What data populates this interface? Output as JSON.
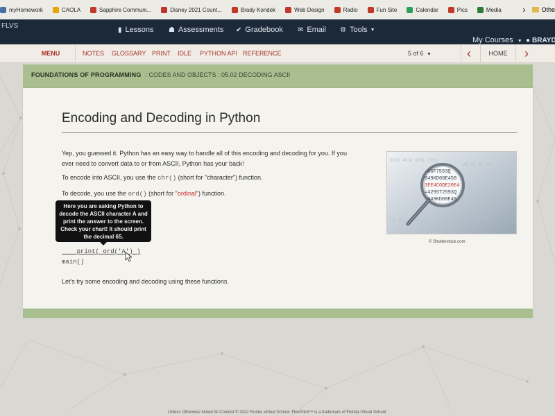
{
  "bookmarks": [
    {
      "label": "myHomework",
      "color": "#4a6fa5"
    },
    {
      "label": "CAOLA",
      "color": "#e8a500"
    },
    {
      "label": "Sapphire Communi...",
      "color": "#c0392b"
    },
    {
      "label": "Disney 2021 Count...",
      "color": "#b33"
    },
    {
      "label": "Brady Kondek",
      "color": "#c0392b"
    },
    {
      "label": "Web Design",
      "color": "#c0392b"
    },
    {
      "label": "Radio",
      "color": "#c0392b"
    },
    {
      "label": "Fun Site",
      "color": "#c0392b"
    },
    {
      "label": "Calendar",
      "color": "#2f9e5a"
    },
    {
      "label": "Pics",
      "color": "#c0392b"
    },
    {
      "label": "Media",
      "color": "#2e7d32"
    }
  ],
  "bookmarks_overflow": "›",
  "bookmarks_other": "Othe",
  "topnav": {
    "brand": "FLVS",
    "items": [
      {
        "label": "Lessons",
        "icon": "book-icon"
      },
      {
        "label": "Assessments",
        "icon": "assessment-icon"
      },
      {
        "label": "Gradebook",
        "icon": "check-icon"
      },
      {
        "label": "Email",
        "icon": "mail-icon"
      },
      {
        "label": "Tools",
        "icon": "gear-icon"
      }
    ],
    "my_courses": "My Courses",
    "user": "BRAYD"
  },
  "menubar": {
    "menu_label": "MENU",
    "items": [
      "NOTES",
      "GLOSSARY",
      "PRINT",
      "IDLE",
      "PYTHON API",
      "REFERENCE"
    ],
    "pager": "5 of 6",
    "home": "HOME"
  },
  "course": {
    "name": "FOUNDATIONS OF PROGRAMMING",
    "breadcrumb": ": CODES AND OBJECTS : 05.02 DECODING ASCII"
  },
  "lesson": {
    "title": "Encoding and Decoding in Python",
    "para1": "Yep, you guessed it. Python has an easy way to handle all of this encoding and decoding for you. If you",
    "para1b": "ever need to convert data to or from ASCII, Python has your back!",
    "encode_pre": "To encode into ASCII, you use the ",
    "encode_code": "chr()",
    "encode_post": " (short for \"character\") function.",
    "decode_pre": "To decode, you use the ",
    "decode_code": "ord()",
    "decode_mid": " (short for \"",
    "decode_ordinal": "ordinal",
    "decode_post": "\") function.",
    "tooltip": "Here you are asking Python to decode the ASCII character A and print the answer to the screen. Check your chart! It should print the decimal 65.",
    "code_line1": "    print( ord('A') )",
    "code_line2": "main()",
    "closing": "Let's try some encoding and decoding using these functions.",
    "image_credit": "© Shutterstock.com",
    "image_text": [
      "A6F7593Q",
      "049KD00E458",
      "3FE4CODE20E4",
      "=4295T2593Q",
      "049KD00E45"
    ]
  },
  "footer": "Unless Otherwise Noted All Content © 2022 Florida Virtual School. FlexPoint™ is a trademark of Florida Virtual School."
}
